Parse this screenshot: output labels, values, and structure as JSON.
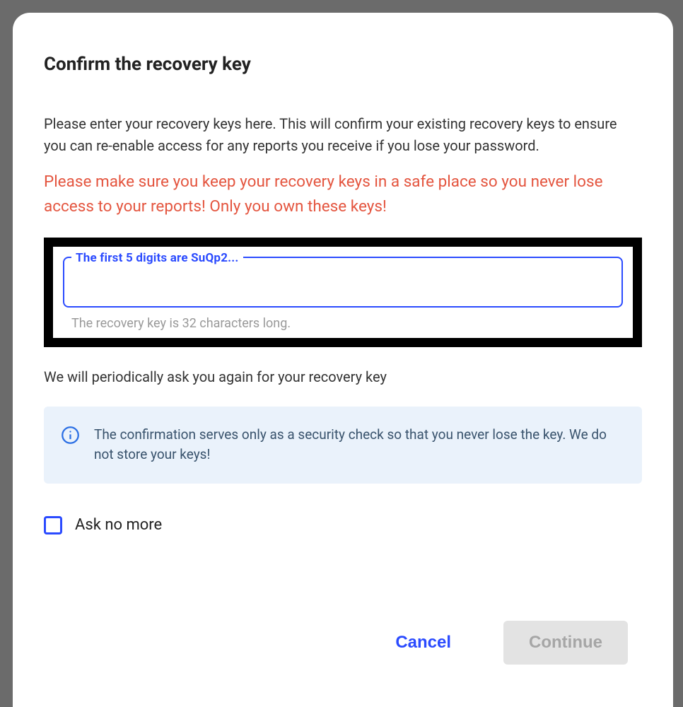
{
  "modal": {
    "title": "Confirm the recovery key",
    "description": "Please enter your recovery keys here. This will confirm your existing recovery keys to ensure you can re-enable access for any reports you receive if you lose your password.",
    "warning": "Please make sure you keep your recovery keys in a safe place so you never lose access to your reports! Only you own these keys!",
    "input": {
      "legend": "The first 5 digits are SuQp2...",
      "value": "",
      "helper": "The recovery key is 32 characters long."
    },
    "periodic": "We will periodically ask you again for your recovery key",
    "info": "The confirmation serves only as a security check so that you never lose the key. We do not store your keys!",
    "checkbox_label": "Ask no more",
    "actions": {
      "cancel": "Cancel",
      "continue": "Continue"
    }
  }
}
